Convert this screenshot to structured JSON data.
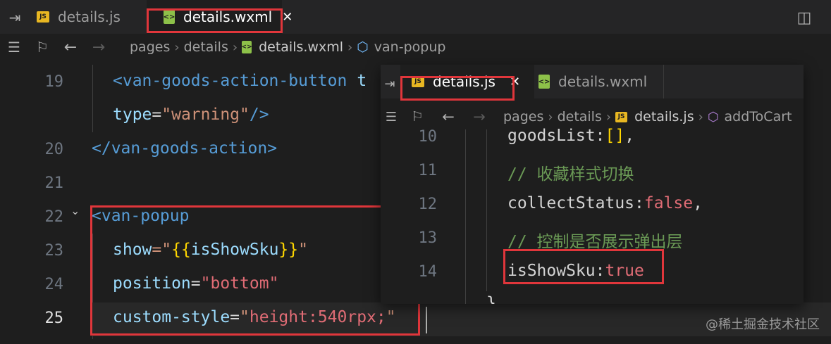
{
  "main_tabs": [
    {
      "label": "details.js",
      "badge": "JS",
      "active": false
    },
    {
      "label": "details.wxml",
      "badge": "<>",
      "active": true,
      "close": "✕"
    }
  ],
  "main_breadcrumb": {
    "items": [
      "pages",
      "details",
      "details.wxml",
      "van-popup"
    ]
  },
  "main_code": {
    "lines": [
      {
        "num": "19",
        "text": "<van-goods-action-button t"
      },
      {
        "num": "",
        "text": "type=\"warning\"/>"
      },
      {
        "num": "20",
        "text": "</van-goods-action>"
      },
      {
        "num": "21",
        "text": ""
      },
      {
        "num": "22",
        "text": "<van-popup"
      },
      {
        "num": "23",
        "text": "show=\"{{isShowSku}}\""
      },
      {
        "num": "24",
        "text": "position=\"bottom\""
      },
      {
        "num": "25",
        "text": "custom-style=\"height:540rpx;\""
      }
    ],
    "l19_tag": "<van-goods-action-button",
    "l19_tail": "t",
    "l19b_attr": "type",
    "l19b_eq": "=",
    "l19b_val": "\"warning\"",
    "l19b_end": "/>",
    "l20_tag": "</van-goods-action>",
    "l22_tag": "<van-popup",
    "l23_attr": "show",
    "l23_eq": "=\"",
    "l23_open": "{{",
    "l23_var": "isShowSku",
    "l23_close": "}}",
    "l23_end": "\"",
    "l24_attr": "position",
    "l24_eq": "=",
    "l24_val": "\"bottom\"",
    "l25_attr": "custom-style",
    "l25_eq": "=",
    "l25_q1": "\"",
    "l25_val": "height:540rpx;",
    "l25_q2": "\""
  },
  "overlay": {
    "tabs": [
      {
        "label": "details.js",
        "badge": "JS",
        "active": true,
        "close": "✕"
      },
      {
        "label": "details.wxml",
        "badge": "<>",
        "active": false
      }
    ],
    "breadcrumb": [
      "pages",
      "details",
      "details.js",
      "addToCart"
    ],
    "lines": [
      {
        "num": "10",
        "key": "goodsList",
        "colon": ":",
        "val": "[]",
        "end": ","
      },
      {
        "num": "11",
        "comment": "// 收藏样式切换"
      },
      {
        "num": "12",
        "key": "collectStatus",
        "colon": ":",
        "val": "false",
        "end": ","
      },
      {
        "num": "13",
        "comment": "// 控制是否展示弹出层"
      },
      {
        "num": "14",
        "key": "isShowSku",
        "colon": ":",
        "val": "true",
        "end": ""
      }
    ],
    "partial_tail": "}"
  },
  "watermark": "@稀土掘金技术社区",
  "colors": {
    "highlight_red": "#e0363b",
    "js_badge": "#e8b722",
    "wxml_badge": "#8dc149"
  }
}
